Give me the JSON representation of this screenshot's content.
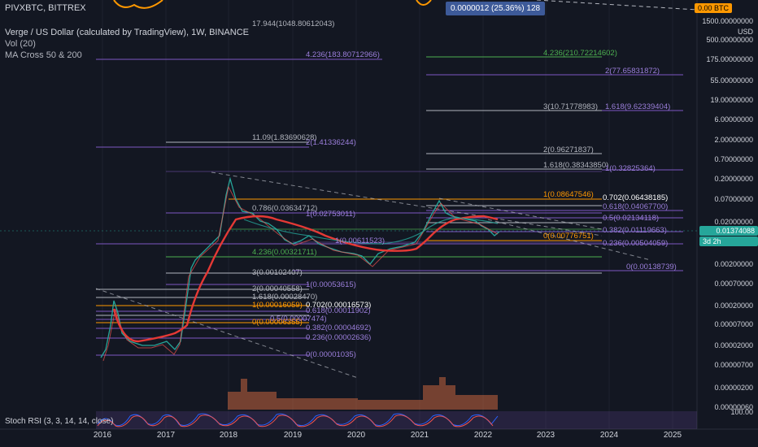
{
  "header": {
    "symbol": "PIVXBTC, BITTREX",
    "title": "Verge / US Dollar (calculated by TradingView), 1W, BINANCE",
    "indicator_vol": "Vol (20)",
    "indicator_ma": "MA Cross 50 & 200",
    "top_label": "17.944(1048.80612043)"
  },
  "tooltip": {
    "text": "0.0000012 (25.36%) 128"
  },
  "price_axis": {
    "currency_badge": "0.00 BTC",
    "unit": "USD",
    "ticks": [
      "1500.00000000",
      "500.00000000",
      "175.00000000",
      "55.00000000",
      "19.00000000",
      "6.00000000",
      "2.00000000",
      "0.70000000",
      "0.20000000",
      "0.07000000",
      "0.02000000",
      "0.00600000",
      "0.00200000",
      "0.00070000",
      "0.00020000",
      "0.00007000",
      "0.00002000",
      "0.00000700",
      "0.00000200",
      "0.00000060"
    ],
    "current_price": "0.01374088",
    "countdown": "3d 2h",
    "stoch_tick": "100.00"
  },
  "time_axis": {
    "ticks": [
      "2016",
      "2017",
      "2018",
      "2019",
      "2020",
      "2021",
      "2022",
      "2023",
      "2024",
      "2025"
    ]
  },
  "fib_labels": [
    {
      "text": "4.236(183.80712966)",
      "color": "#9c7fdc"
    },
    {
      "text": "4.236(210.72214602)",
      "color": "#4caf50"
    },
    {
      "text": "2(77.65831872)",
      "color": "#9c7fdc"
    },
    {
      "text": "3(10.71778983)",
      "color": "#b2b5be"
    },
    {
      "text": "1.618(9.62339404)",
      "color": "#9c7fdc"
    },
    {
      "text": "11.09(1.83690628)",
      "color": "#b2b5be"
    },
    {
      "text": "2(1.41336244)",
      "color": "#9c7fdc"
    },
    {
      "text": "2(0.96271837)",
      "color": "#b2b5be"
    },
    {
      "text": "1.618(0.38343850)",
      "color": "#b2b5be"
    },
    {
      "text": "1(0.32825364)",
      "color": "#9c7fdc"
    },
    {
      "text": "1(0.08647546)",
      "color": "#ff9800"
    },
    {
      "text": "0.702(0.06438185)",
      "color": "#ffffff"
    },
    {
      "text": "0.618(0.04067700)",
      "color": "#9c7fdc"
    },
    {
      "text": "0.786(0.03634712)",
      "color": "#b2b5be"
    },
    {
      "text": "1(0.02753011)",
      "color": "#9c7fdc"
    },
    {
      "text": "0.5(0.02134118)",
      "color": "#9c7fdc"
    },
    {
      "text": "0.382(0.01119663)",
      "color": "#9c7fdc"
    },
    {
      "text": "1(0.00611523)",
      "color": "#9c7fdc"
    },
    {
      "text": "0(0.00776751)",
      "color": "#ff9800"
    },
    {
      "text": "0.236(0.00504059)",
      "color": "#9c7fdc"
    },
    {
      "text": "4.236(0.00321711)",
      "color": "#4caf50"
    },
    {
      "text": "0(0.00138739)",
      "color": "#9c7fdc"
    },
    {
      "text": "3(0.00102407)",
      "color": "#b2b5be"
    },
    {
      "text": "1(0.00053615)",
      "color": "#9c7fdc"
    },
    {
      "text": "2(0.00040558)",
      "color": "#b2b5be"
    },
    {
      "text": "1.618(0.00028470)",
      "color": "#b2b5be"
    },
    {
      "text": "1(0.00016059)",
      "color": "#ff9800"
    },
    {
      "text": "0.702(0.00016573)",
      "color": "#ffffff"
    },
    {
      "text": "0.618(0.00011902)",
      "color": "#9c7fdc"
    },
    {
      "text": "0.5(0.00007474)",
      "color": "#9c7fdc"
    },
    {
      "text": "0(0.00006355)",
      "color": "#ff9800"
    },
    {
      "text": "0.382(0.00004692)",
      "color": "#9c7fdc"
    },
    {
      "text": "0.236(0.00002636)",
      "color": "#9c7fdc"
    },
    {
      "text": "0(0.00001035)",
      "color": "#9c7fdc"
    }
  ],
  "stoch_rsi": {
    "label": "Stoch RSI (3, 3, 14, 14, close)"
  },
  "colors": {
    "background": "#131722",
    "fib_purple": "#7e57c2",
    "fib_orange": "#ff9800",
    "fib_green": "#4caf50",
    "ma_red": "#e53935",
    "ma_green": "#26a69a",
    "candle_up": "#26a69a",
    "candle_down": "#ef5350",
    "accent_blue": "#2962ff",
    "price_tag": "#26a69a",
    "badge_orange": "#ff9800"
  }
}
